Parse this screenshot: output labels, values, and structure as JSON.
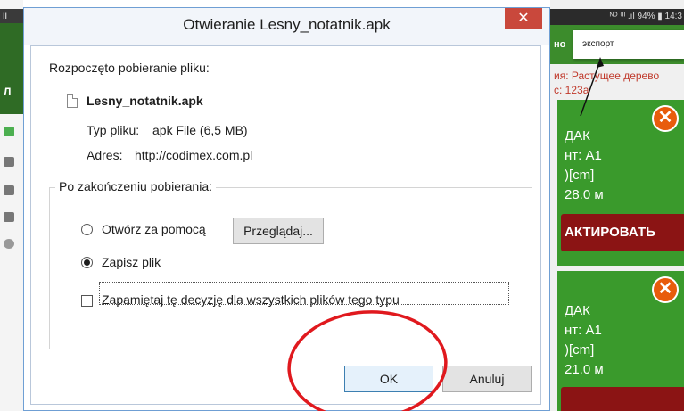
{
  "dialog": {
    "title": "Otwieranie Lesny_notatnik.apk",
    "close_symbol": "✕",
    "started_text": "Rozpoczęto pobieranie pliku:",
    "file_name": "Lesny_notatnik.apk",
    "file_type_label": "Typ pliku:",
    "file_type_value": "apk File (6,5 MB)",
    "address_label": "Adres:",
    "address_value": "http://codimex.com.pl",
    "after_download_label": "Po zakończeniu pobierania:",
    "open_with_label": "Otwórz za pomocą",
    "browse_button": "Przeglądaj...",
    "save_file_label": "Zapisz plik",
    "remember_label": "Zapamiętaj tę decyzję dla wszystkich plików tego typu",
    "ok_button": "OK",
    "cancel_button": "Anuluj",
    "selected_option": "save_file",
    "remember_checked": false
  },
  "background_app": {
    "status_text": "ᴺᴰ ⁽ᴵᴵ .ıl 94% ▮ 14:3",
    "left_status": "II",
    "header_fragment": "но",
    "export_menu_item": "экспорт",
    "info_line_1": "ия: Растущее дерево",
    "info_line_2": "с: 123а",
    "card_1": {
      "line1": "ДАК",
      "line2": "нт: А1",
      "line3": ")[cm]",
      "line4": "28.0 м",
      "button": "АКТИРОВАТЬ"
    },
    "card_2": {
      "line1": "ДАК",
      "line2": "нт: А1",
      "line3": ")[cm]",
      "line4": "21.0 м"
    },
    "close_symbol": "✕",
    "left_letter": "Л"
  },
  "colors": {
    "accent_red_annotation": "#e0191e",
    "titlebar_close": "#c9483c",
    "app_green": "#3a9a2c",
    "app_dark_red_button": "#8b1414"
  }
}
